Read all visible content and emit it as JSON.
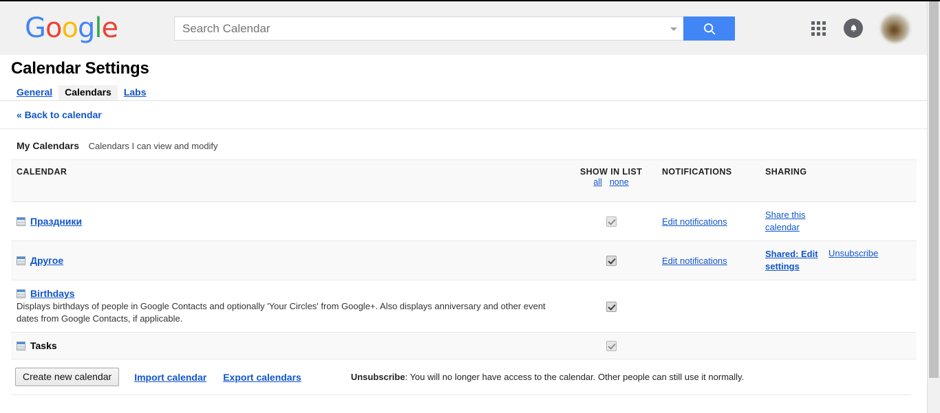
{
  "gbar": {
    "logo": "Google",
    "search": {
      "placeholder": "Search Calendar",
      "value": "",
      "button_label": "search-icon"
    },
    "apps_label": "Google apps",
    "notifications_label": "Notifications",
    "account_label": "Account"
  },
  "settings": {
    "title": "Calendar Settings",
    "tabs": [
      {
        "label": "General",
        "active": false
      },
      {
        "label": "Calendars",
        "active": true
      },
      {
        "label": "Labs",
        "active": false
      }
    ],
    "back_link": "« Back to calendar"
  },
  "section": {
    "title": "My Calendars",
    "subtitle": "Calendars I can view and modify"
  },
  "table": {
    "headers": {
      "calendar": "CALENDAR",
      "show_in_list": "SHOW IN LIST",
      "show_all": "all",
      "show_none": "none",
      "notifications": "NOTIFICATIONS",
      "sharing": "SHARING"
    },
    "rows": [
      {
        "name": "Праздники",
        "is_link": true,
        "description": "",
        "checked": true,
        "notifications": "Edit notifications",
        "sharing_main": "Share this calendar",
        "sharing_secondary": ""
      },
      {
        "name": "Другое",
        "is_link": true,
        "description": "",
        "checked": true,
        "notifications": "Edit notifications",
        "sharing_main": "Shared: Edit settings",
        "sharing_secondary": "Unsubscribe"
      },
      {
        "name": "Birthdays",
        "is_link": true,
        "description": "Displays birthdays of people in Google Contacts and optionally 'Your Circles' from Google+. Also displays anniversary and other event dates from Google Contacts, if applicable.",
        "checked": true,
        "notifications": "",
        "sharing_main": "",
        "sharing_secondary": ""
      },
      {
        "name": "Tasks",
        "is_link": false,
        "description": "",
        "checked": true,
        "notifications": "",
        "sharing_main": "",
        "sharing_secondary": ""
      }
    ]
  },
  "bottom": {
    "create_button": "Create new calendar",
    "import_link": "Import calendar",
    "export_link": "Export calendars",
    "unsubscribe_term": "Unsubscribe",
    "unsubscribe_note": ": You will no longer have access to the calendar. Other people can still use it normally."
  },
  "colors": {
    "accent_blue": "#4285f4",
    "link_blue": "#1155cc",
    "bar_bg": "#f1f1f1",
    "row_shade": "#f9f9f9"
  }
}
